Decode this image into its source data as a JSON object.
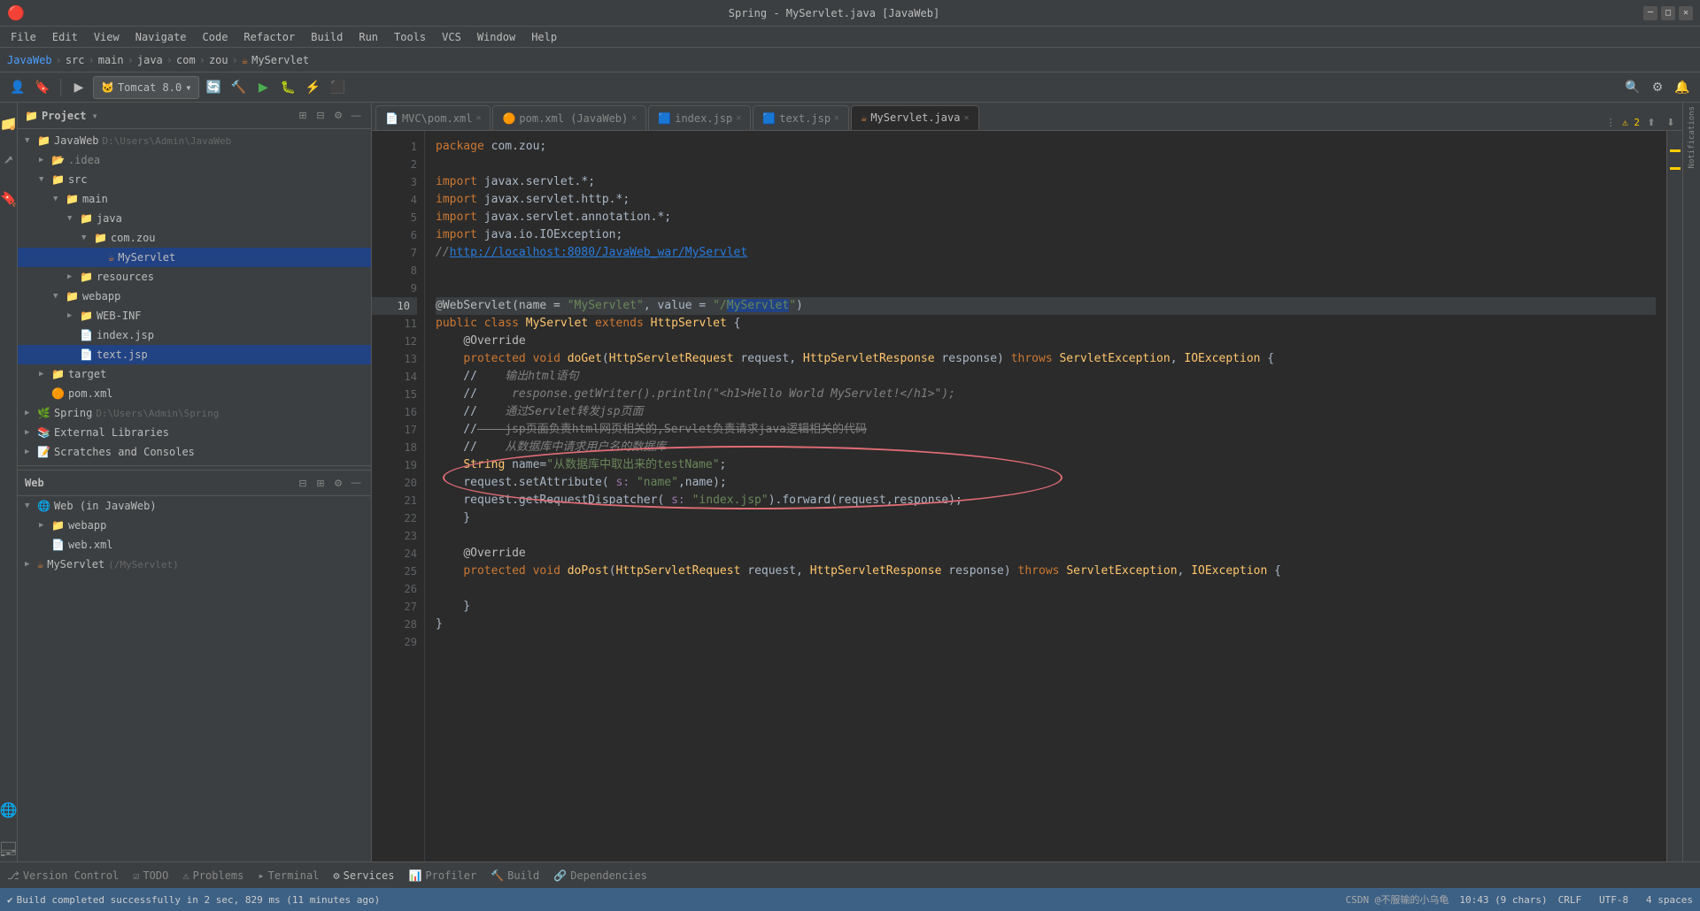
{
  "app": {
    "title": "Spring - MyServlet.java [JavaWeb]",
    "logo": "🔴"
  },
  "menu": {
    "items": [
      "File",
      "Edit",
      "View",
      "Navigate",
      "Code",
      "Refactor",
      "Build",
      "Run",
      "Tools",
      "VCS",
      "Window",
      "Help"
    ]
  },
  "breadcrumb": {
    "items": [
      "JavaWeb",
      "src",
      "main",
      "java",
      "com",
      "zou",
      "MyServlet"
    ]
  },
  "toolbar": {
    "tomcat": "Tomcat 8.0"
  },
  "tabs": [
    {
      "label": "MVC\\pom.xml",
      "icon": "📄",
      "active": false
    },
    {
      "label": "pom.xml (JavaWeb)",
      "icon": "🟠",
      "active": false
    },
    {
      "label": "index.jsp",
      "icon": "🟦",
      "active": false
    },
    {
      "label": "text.jsp",
      "icon": "🟦",
      "active": false
    },
    {
      "label": "MyServlet.java",
      "icon": "☕",
      "active": true
    }
  ],
  "project_panel": {
    "title": "Project",
    "root": {
      "name": "JavaWeb",
      "path": "D:\\Users\\Admin\\JavaWeb"
    }
  },
  "code": {
    "lines": [
      {
        "num": 1,
        "content": "package com.zou;"
      },
      {
        "num": 2,
        "content": ""
      },
      {
        "num": 3,
        "content": "import javax.servlet.*;"
      },
      {
        "num": 4,
        "content": "import javax.servlet.http.*;"
      },
      {
        "num": 5,
        "content": "import javax.servlet.annotation.*;"
      },
      {
        "num": 6,
        "content": "import java.io.IOException;"
      },
      {
        "num": 7,
        "content": "//http://localhost:8080/JavaWeb_war/MyServlet"
      },
      {
        "num": 8,
        "content": ""
      },
      {
        "num": 9,
        "content": ""
      },
      {
        "num": 10,
        "content": "@WebServlet(name = \"MyServlet\", value = \"/MyServlet\")"
      },
      {
        "num": 11,
        "content": "public class MyServlet extends HttpServlet {"
      },
      {
        "num": 12,
        "content": "    @Override"
      },
      {
        "num": 13,
        "content": "    protected void doGet(HttpServletRequest request, HttpServletResponse response) throws ServletException, IOException {"
      },
      {
        "num": 14,
        "content": "        //  输出html语句"
      },
      {
        "num": 15,
        "content": "        //  response.getWriter().println(\"<h1>Hello World MyServlet!</h1>\");"
      },
      {
        "num": 16,
        "content": "        //  通过Servlet转发jsp页面"
      },
      {
        "num": 17,
        "content": "        //  jsp页面负责html网页相关的,Servlet负责请求java逻辑相关的代码"
      },
      {
        "num": 18,
        "content": "        //  从数据库中请求用户名的数据库"
      },
      {
        "num": 19,
        "content": "        String name=\"从数据库中取出来的testName\";"
      },
      {
        "num": 20,
        "content": "        request.setAttribute( s: \"name\",name);"
      },
      {
        "num": 21,
        "content": "        request.getRequestDispatcher( s: \"index.jsp\").forward(request,response);"
      },
      {
        "num": 22,
        "content": "    }"
      },
      {
        "num": 23,
        "content": ""
      },
      {
        "num": 24,
        "content": "    @Override"
      },
      {
        "num": 25,
        "content": "    protected void doPost(HttpServletRequest request, HttpServletResponse response) throws ServletException, IOException {"
      },
      {
        "num": 26,
        "content": ""
      },
      {
        "num": 27,
        "content": "    }"
      },
      {
        "num": 28,
        "content": "}"
      },
      {
        "num": 29,
        "content": ""
      }
    ]
  },
  "bottom_bar": {
    "items": [
      "Version Control",
      "TODO",
      "Problems",
      "Terminal",
      "Services",
      "Profiler",
      "Build",
      "Dependencies"
    ]
  },
  "status_bar": {
    "left": "Build completed successfully in 2 sec, 829 ms (11 minutes ago)",
    "position": "CRLF  UTF-8  4 spaces",
    "cursor": "10:43 (9 chars)",
    "warnings": "2",
    "watermark": "CSDN @不服输的小乌龟"
  }
}
